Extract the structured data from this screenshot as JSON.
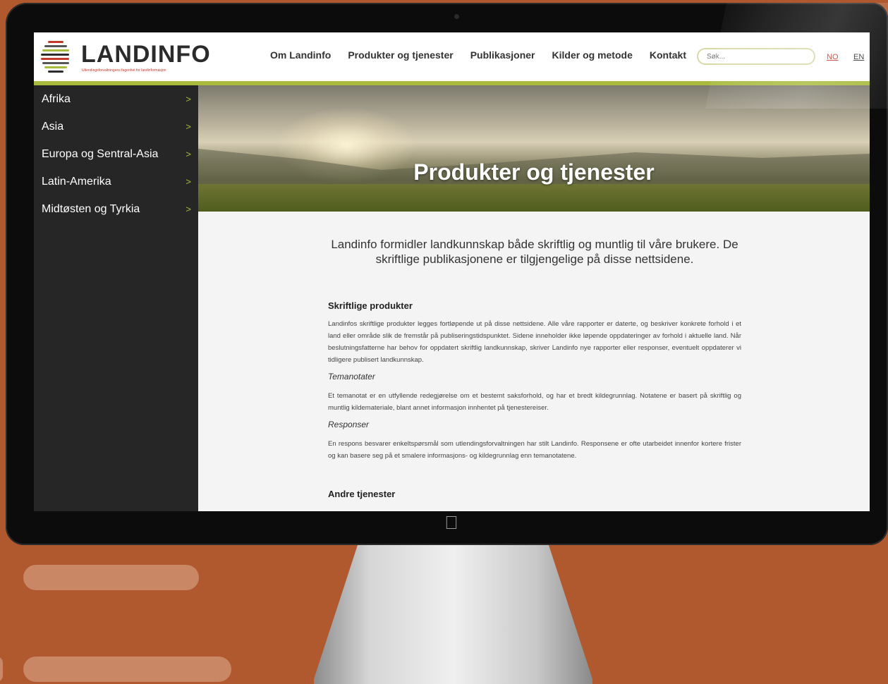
{
  "header": {
    "logo_name": "LANDINFO",
    "logo_tagline": "Utlendingsforvaltningens fagenhet for landinformasjon",
    "nav": [
      "Om Landinfo",
      "Produkter og tjenester",
      "Publikasjoner",
      "Kilder og metode",
      "Kontakt"
    ],
    "search_placeholder": "Søk...",
    "lang_no": "NO",
    "lang_en": "EN"
  },
  "sidebar": {
    "items": [
      {
        "label": "Afrika",
        "chevron": ">"
      },
      {
        "label": "Asia",
        "chevron": ">"
      },
      {
        "label": "Europa og Sentral-Asia",
        "chevron": ">"
      },
      {
        "label": "Latin-Amerika",
        "chevron": ">"
      },
      {
        "label": "Midtøsten og Tyrkia",
        "chevron": ">"
      }
    ]
  },
  "hero": {
    "title": "Produkter og tjenester"
  },
  "main": {
    "intro": "Landinfo formidler landkunnskap både skriftlig og muntlig til våre brukere. De skriftlige publikasjonene er tilgjengelige på disse nettsidene.",
    "section1_title": "Skriftlige produkter",
    "section1_body": "Landinfos skriftlige produkter legges fortløpende ut på disse nettsidene. Alle våre rapporter er daterte, og beskriver konkrete forhold i et land eller område slik de fremstår på publiseringstidspunktet. Sidene inneholder ikke løpende oppdateringer av forhold i aktuelle land. Når beslutningsfatterne har behov for oppdatert skriftlig landkunnskap, skriver Landinfo nye rapporter eller responser, eventuelt oppdaterer vi tidligere publisert landkunnskap.",
    "temanotater_title": "Temanotater",
    "temanotater_body": "Et temanotat er en utfyllende redegjørelse om et bestemt saksforhold, og har et bredt kildegrunnlag. Notatene er basert på skriftlig og muntlig kildemateriale, blant annet informasjon innhentet på tjenestereiser.",
    "responser_title": "Responser",
    "responser_body": "En respons besvarer enkeltspørsmål som utlendingsforvaltningen har stilt Landinfo. Responsene er ofte utarbeidet innenfor kortere frister og kan basere seg på et smalere informasjons- og kildegrunnlag enn temanotatene.",
    "section2_title": "Andre tjenester"
  },
  "colors": {
    "accent_green": "#a9bb3d",
    "sidebar_bg": "#262626",
    "background_orange": "#b0592f",
    "lang_active": "#c0392b"
  }
}
